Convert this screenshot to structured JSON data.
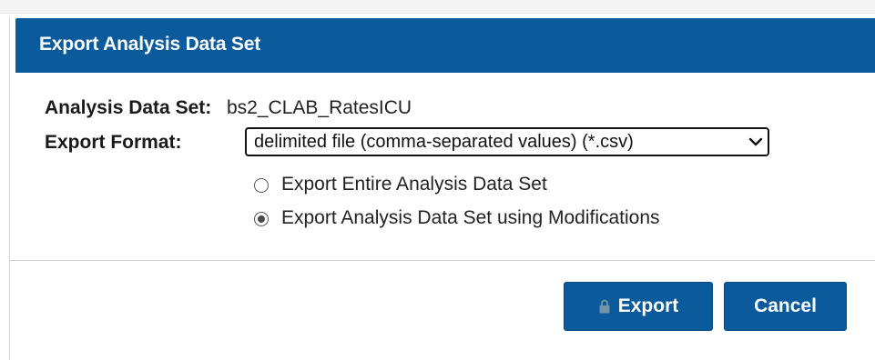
{
  "dialog": {
    "title": "Export Analysis Data Set"
  },
  "fields": {
    "dataset_label": "Analysis Data Set:",
    "dataset_value": "bs2_CLAB_RatesICU",
    "format_label": "Export Format:",
    "format_selected": "delimited file (comma-separated values) (*.csv)"
  },
  "options": [
    {
      "label": "Export Entire Analysis Data Set",
      "checked": false
    },
    {
      "label": "Export Analysis Data Set using Modifications",
      "checked": true
    }
  ],
  "buttons": {
    "export_label": "Export",
    "cancel_label": "Cancel"
  },
  "colors": {
    "header_bg": "#0a5a9c",
    "button_bg": "#0a5a9c"
  },
  "icons": {
    "export_button_icon": "lock-icon",
    "select_icon": "chevron-down-icon"
  }
}
